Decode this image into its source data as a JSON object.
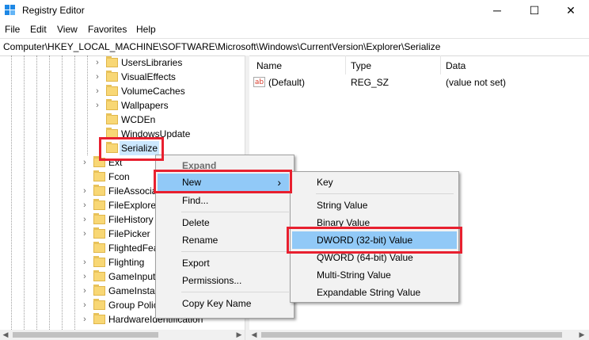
{
  "window": {
    "title": "Registry Editor",
    "controls": {
      "minimize": "─",
      "maximize": "☐",
      "close": "✕"
    }
  },
  "menu": [
    "File",
    "Edit",
    "View",
    "Favorites",
    "Help"
  ],
  "address": "Computer\\HKEY_LOCAL_MACHINE\\SOFTWARE\\Microsoft\\Windows\\CurrentVersion\\Explorer\\Serialize",
  "tree": [
    {
      "label": "UsersLibraries",
      "expandable": true
    },
    {
      "label": "VisualEffects",
      "expandable": true
    },
    {
      "label": "VolumeCaches",
      "expandable": true
    },
    {
      "label": "Wallpapers",
      "expandable": true
    },
    {
      "label": "WCDEn",
      "expandable": false
    },
    {
      "label": "WindowsUpdate",
      "expandable": false
    },
    {
      "label": "Serialize",
      "expandable": false,
      "selected": true
    },
    {
      "label": "Ext",
      "expandable": true
    },
    {
      "label": "Fcon",
      "expandable": false
    },
    {
      "label": "FileAssocia",
      "expandable": true
    },
    {
      "label": "FileExplore",
      "expandable": true
    },
    {
      "label": "FileHistory",
      "expandable": true
    },
    {
      "label": "FilePicker",
      "expandable": true
    },
    {
      "label": "FlightedFea",
      "expandable": false
    },
    {
      "label": "Flighting",
      "expandable": true
    },
    {
      "label": "GameInput",
      "expandable": true
    },
    {
      "label": "GameInstal",
      "expandable": true
    },
    {
      "label": "Group Polic",
      "expandable": true
    },
    {
      "label": "HardwareIdentification",
      "expandable": true
    }
  ],
  "list": {
    "columns": [
      "Name",
      "Type",
      "Data"
    ],
    "rows": [
      {
        "icon": "ab",
        "name": "(Default)",
        "type": "REG_SZ",
        "data": "(value not set)"
      }
    ]
  },
  "context_menu": {
    "items": [
      "Expand",
      "New",
      "Find...",
      "Delete",
      "Rename",
      "Export",
      "Permissions...",
      "Copy Key Name"
    ],
    "submenu_arrow": "›",
    "highlighted": "New"
  },
  "new_submenu": {
    "items": [
      "Key",
      "String Value",
      "Binary Value",
      "DWORD (32-bit) Value",
      "QWORD (64-bit) Value",
      "Multi-String Value",
      "Expandable String Value"
    ],
    "highlighted": "DWORD (32-bit) Value"
  },
  "colors": {
    "highlight": "#91c9f7",
    "annotation": "#e8202f",
    "folder": "#f8d775"
  }
}
